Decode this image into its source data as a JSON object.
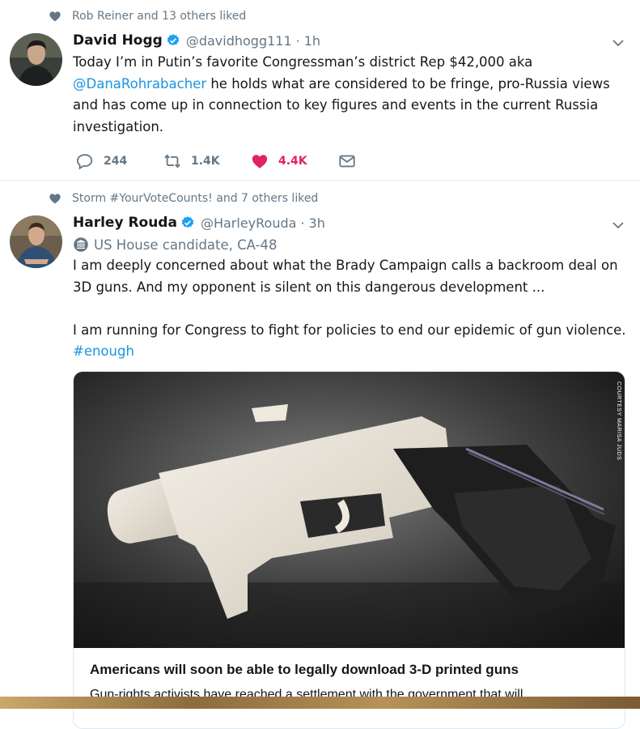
{
  "tweets": [
    {
      "context": "Rob Reiner and 13 others liked",
      "name": "David Hogg",
      "handle": "@davidhogg111",
      "dot": "·",
      "time": "1h",
      "text_before": "Today I’m in Putin’s favorite Congressman’s  district Rep $42,000 aka ",
      "mention": "@DanaRohrabacher",
      "text_after": " he holds what are considered to be fringe, pro-Russia views and has come up in connection to key figures and events in the current Russia investigation.",
      "replies": "244",
      "retweets": "1.4K",
      "likes": "4.4K"
    },
    {
      "context": "Storm #YourVoteCounts! and 7 others liked",
      "name": "Harley Rouda",
      "handle": "@HarleyRouda",
      "dot": "·",
      "time": "3h",
      "bio": "US House candidate, CA-48",
      "para1": "I am deeply concerned about what the Brady Campaign calls a backroom deal on 3D guns.  And my opponent is silent on this dangerous development ...",
      "para2": "I am running for Congress to fight for policies to end our epidemic of gun violence. ",
      "hashtag": "#enough",
      "card": {
        "credit": "COURTESY MARISA JUDS",
        "title": "Americans will soon be able to legally download 3-D printed guns",
        "description": "Gun-rights activists have reached a settlement with the government that will"
      }
    }
  ],
  "colors": {
    "link": "#1b95e0",
    "like": "#e0245e",
    "muted": "#657786",
    "verified": "#1da1f2"
  },
  "icons": [
    "heart-icon",
    "verified-badge-icon",
    "chevron-down-icon",
    "reply-icon",
    "retweet-icon",
    "like-icon",
    "message-icon",
    "building-icon"
  ]
}
